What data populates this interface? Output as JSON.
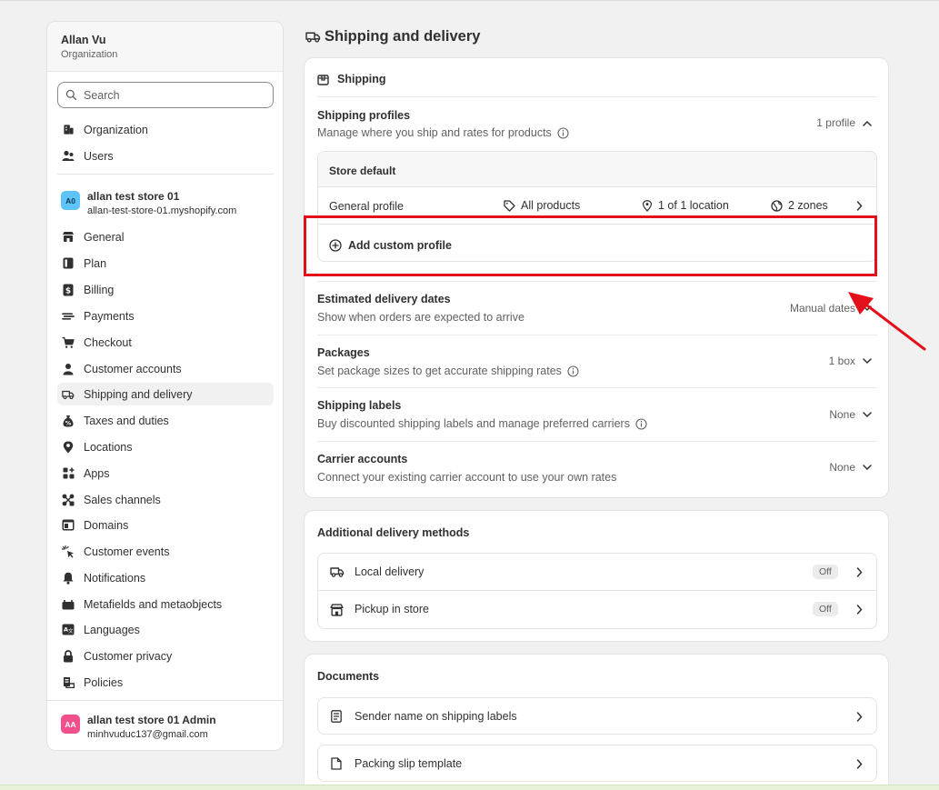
{
  "sidebar": {
    "org_name": "Allan Vu",
    "org_sub": "Organization",
    "search_placeholder": "Search",
    "top_items": [
      {
        "label": "Organization",
        "icon": "building-icon"
      },
      {
        "label": "Users",
        "icon": "users-icon"
      }
    ],
    "store": {
      "badge": "A0",
      "name": "allan test store 01",
      "domain": "allan-test-store-01.myshopify.com",
      "badge_color": "#5ec3f7"
    },
    "items": [
      {
        "label": "General",
        "icon": "store-icon"
      },
      {
        "label": "Plan",
        "icon": "plan-icon"
      },
      {
        "label": "Billing",
        "icon": "billing-icon"
      },
      {
        "label": "Payments",
        "icon": "payments-icon"
      },
      {
        "label": "Checkout",
        "icon": "cart-icon"
      },
      {
        "label": "Customer accounts",
        "icon": "person-icon"
      },
      {
        "label": "Shipping and delivery",
        "icon": "truck-icon"
      },
      {
        "label": "Taxes and duties",
        "icon": "money-bag-icon"
      },
      {
        "label": "Locations",
        "icon": "location-pin-icon"
      },
      {
        "label": "Apps",
        "icon": "apps-icon"
      },
      {
        "label": "Sales channels",
        "icon": "channels-icon"
      },
      {
        "label": "Domains",
        "icon": "domains-icon"
      },
      {
        "label": "Customer events",
        "icon": "cursor-click-icon"
      },
      {
        "label": "Notifications",
        "icon": "bell-icon"
      },
      {
        "label": "Metafields and metaobjects",
        "icon": "metafields-icon"
      },
      {
        "label": "Languages",
        "icon": "language-icon"
      },
      {
        "label": "Customer privacy",
        "icon": "lock-icon"
      },
      {
        "label": "Policies",
        "icon": "policies-icon"
      }
    ],
    "active_item": "Shipping and delivery",
    "account": {
      "badge": "AA",
      "name": "allan test store 01 Admin",
      "email": "minhvuduc137@gmail.com",
      "badge_color": "#f24f8d"
    }
  },
  "page": {
    "title": "Shipping and delivery"
  },
  "shipping": {
    "header": "Shipping",
    "profiles_title": "Shipping profiles",
    "profiles_desc": "Manage where you ship and rates for products",
    "profiles_value": "1 profile",
    "store_default": "Store default",
    "general_profile": "General profile",
    "all_products": "All products",
    "locations": "1 of 1 location",
    "zones": "2 zones",
    "add_custom": "Add custom profile",
    "rows": [
      {
        "title": "Estimated delivery dates",
        "desc": "Show when orders are expected to arrive",
        "value": "Manual dates"
      },
      {
        "title": "Packages",
        "desc": "Set package sizes to get accurate shipping rates",
        "value": "1 box"
      },
      {
        "title": "Shipping labels",
        "desc": "Buy discounted shipping labels and manage preferred carriers",
        "value": "None"
      },
      {
        "title": "Carrier accounts",
        "desc": "Connect your existing carrier account to use your own rates",
        "value": "None"
      }
    ]
  },
  "additional": {
    "title": "Additional delivery methods",
    "items": [
      {
        "label": "Local delivery",
        "status": "Off"
      },
      {
        "label": "Pickup in store",
        "status": "Off"
      }
    ]
  },
  "documents": {
    "title": "Documents",
    "items": [
      {
        "label": "Sender name on shipping labels"
      },
      {
        "label": "Packing slip template"
      }
    ]
  },
  "colors": {
    "highlight": "#e3101b",
    "arrow": "#e3101b"
  }
}
